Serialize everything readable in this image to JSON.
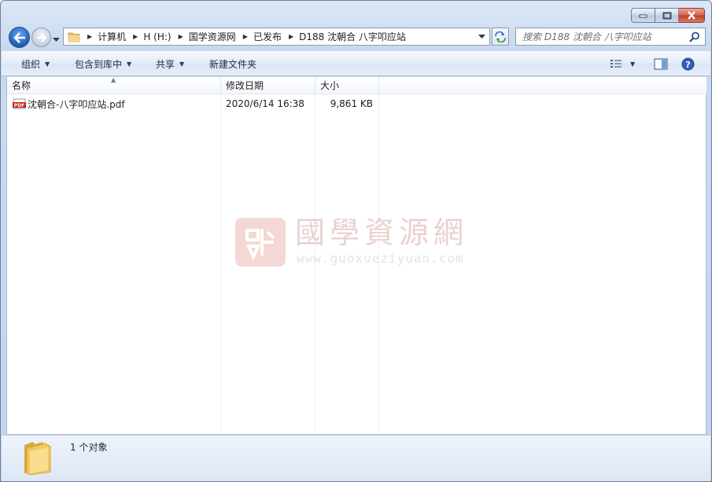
{
  "window": {
    "caption_buttons": [
      "minimize",
      "maximize",
      "close"
    ]
  },
  "address_bar": {
    "crumbs": [
      "计算机",
      "H (H:)",
      "国学资源网",
      "已发布",
      "D188 沈朝合 八字叩应站"
    ]
  },
  "search": {
    "placeholder": "搜索 D188 沈朝合 八字叩应站"
  },
  "toolbar": {
    "organize": "组织",
    "include_in_library": "包含到库中",
    "share": "共享",
    "new_folder": "新建文件夹"
  },
  "columns": {
    "name": "名称",
    "date_modified": "修改日期",
    "size": "大小"
  },
  "files": [
    {
      "name": "沈朝合-八字叩应站.pdf",
      "date_modified": "2020/6/14 16:38",
      "size": "9,861 KB",
      "icon": "pdf-icon"
    }
  ],
  "watermark": {
    "chinese": "國學資源網",
    "url": "www.guoxueziyuan.com"
  },
  "status": {
    "item_count": "1 个对象"
  },
  "colors": {
    "chrome": "#c9daf0",
    "accent_blue": "#1c5fb8",
    "close_red": "#c13b24"
  }
}
